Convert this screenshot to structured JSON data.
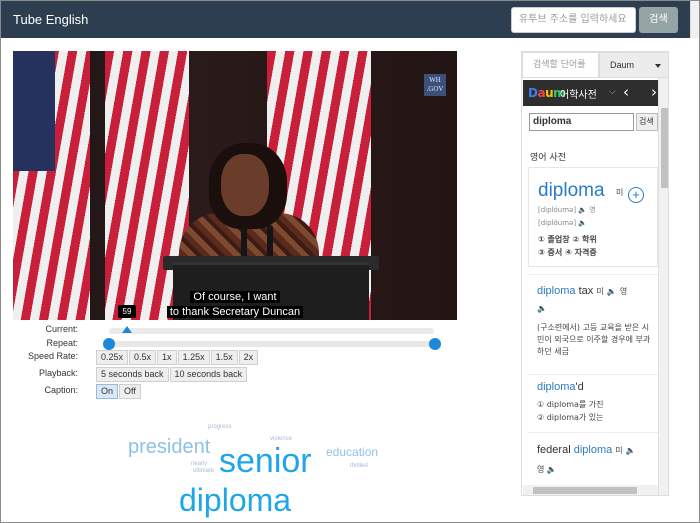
{
  "app": {
    "title": "Tube English"
  },
  "header": {
    "url_placeholder": "유투브 주소를 입력하세요",
    "search_label": "검색"
  },
  "video": {
    "logo_text": "WH .GOV",
    "caption_line1": "Of course, I want",
    "caption_line2": "to thank Secretary Duncan"
  },
  "controls": {
    "current_label": "Current:",
    "current_tooltip": "59",
    "repeat_label": "Repeat:",
    "speed_label": "Speed Rate:",
    "speeds": [
      "0.25x",
      "0.5x",
      "1x",
      "1.25x",
      "1.5x",
      "2x"
    ],
    "playback_label": "Playback:",
    "playback_buttons": [
      "5 seconds back",
      "10 seconds back"
    ],
    "caption_label": "Caption:",
    "caption_on": "On",
    "caption_off": "Off"
  },
  "wordcloud": {
    "words": [
      {
        "text": "progress",
        "color": "#a9b9d3"
      },
      {
        "text": "violence",
        "color": "#a9b9d3"
      },
      {
        "text": "president",
        "color": "#8ec1e8"
      },
      {
        "text": "senior",
        "color": "#1fa6e8"
      },
      {
        "text": "education",
        "color": "#8ec1e8"
      },
      {
        "text": "nearly",
        "color": "#a9b9d3"
      },
      {
        "text": "ultimate",
        "color": "#a9b9d3"
      },
      {
        "text": "thrilled",
        "color": "#a9b9d3"
      },
      {
        "text": "diploma",
        "color": "#1fa6e8"
      }
    ]
  },
  "dictionary": {
    "search_placeholder": "검색할 단어를",
    "provider": "Daum",
    "brand": "Daum",
    "brand_title": "어학사전",
    "query": "diploma",
    "go_label": "검색",
    "section_title": "영어 사전",
    "main_word": "diploma",
    "main_word_suffix": "미",
    "pron1": "[diplóumə]",
    "pron1_tag": "영",
    "pron2": "[diplóumə]",
    "meaning1": "① 졸업장  ② 학위",
    "meaning2": "③ 증서  ④ 자격증",
    "entry2_word": "diploma",
    "entry2_rest": "tax",
    "entry2_tag": "미",
    "entry2_tag2": "영",
    "entry2_def": "(구소련에서) 고등 교육을 받은 시민이 외국으로 이주할 경우에 부과하던 세금",
    "entry3_word": "diploma",
    "entry3_rest": "'d",
    "entry3_line1": "① diploma를 가진",
    "entry3_line2": "② diploma가 있는",
    "entry4_prefix": "federal",
    "entry4_word": "diploma",
    "entry4_tag": "미",
    "entry4_tag2": "영"
  },
  "colors": {
    "navbar": "#2c3e50",
    "accent": "#1e88d8",
    "dict_blue": "#2b7cc5"
  }
}
